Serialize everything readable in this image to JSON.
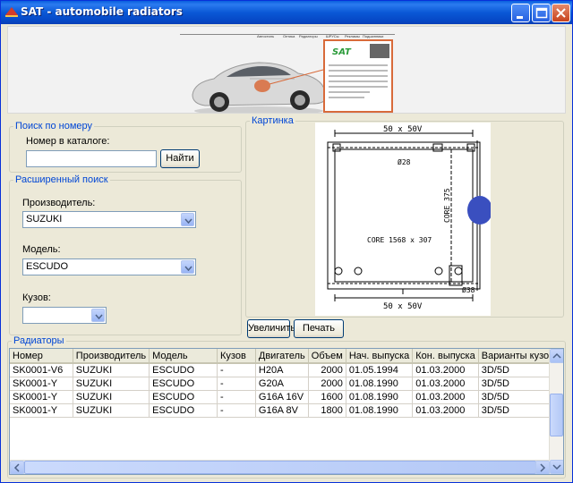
{
  "window": {
    "title": "SAT - automobile radiators"
  },
  "banner": {
    "nav_items": [
      "Автостиль",
      "Оптика",
      "Радиаторы",
      "ШРУСы",
      "Рекламы",
      "Подшипники"
    ],
    "card_logo": "SAT"
  },
  "search_by_number": {
    "legend": "Поиск по номеру",
    "label": "Номер в каталоге:",
    "value": "",
    "find_button": "Найти"
  },
  "advanced_search": {
    "legend": "Расширенный поиск",
    "manufacturer_label": "Производитель:",
    "manufacturer_value": "SUZUKI",
    "model_label": "Модель:",
    "model_value": "ESCUDO",
    "body_label": "Кузов:",
    "body_value": ""
  },
  "picture": {
    "legend": "Картинка",
    "dim_top": "50 x 50V",
    "dim_bottom": "50 x 50V",
    "core_label": "CORE 1568 x 307",
    "core_side": "CORE 375",
    "tag_right": "Ø38",
    "tag_inlet": "Ø28",
    "zoom_button": "Увеличить",
    "print_button": "Печать"
  },
  "radiators": {
    "legend": "Радиаторы",
    "columns": [
      "Номер",
      "Производитель",
      "Модель",
      "Кузов",
      "Двигатель",
      "Объем",
      "Нач. выпуска",
      "Кон. выпуска",
      "Варианты кузова"
    ],
    "rows": [
      [
        "SK0001-V6",
        "SUZUKI",
        "ESCUDO",
        "-",
        "H20A",
        "2000",
        "01.05.1994",
        "01.03.2000",
        "3D/5D"
      ],
      [
        "SK0001-Y",
        "SUZUKI",
        "ESCUDO",
        "-",
        "G20A",
        "2000",
        "01.08.1990",
        "01.03.2000",
        "3D/5D"
      ],
      [
        "SK0001-Y",
        "SUZUKI",
        "ESCUDO",
        "-",
        "G16A 16V",
        "1600",
        "01.08.1990",
        "01.03.2000",
        "3D/5D"
      ],
      [
        "SK0001-Y",
        "SUZUKI",
        "ESCUDO",
        "-",
        "G16A 8V",
        "1800",
        "01.08.1990",
        "01.03.2000",
        "3D/5D"
      ]
    ]
  }
}
